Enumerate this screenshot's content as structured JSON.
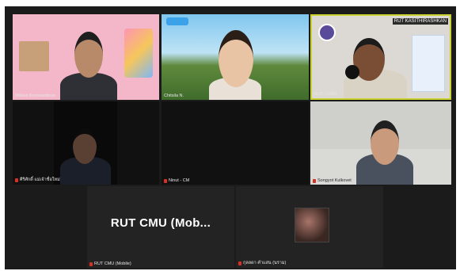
{
  "participants": [
    {
      "name": "Wilwat Komolaritinun",
      "speaking": false
    },
    {
      "name": "Chitsila N.",
      "speaking": false
    },
    {
      "name": "RUT - CMU",
      "speaking": true,
      "overlay": "RUT KASITHIRASHKAN"
    },
    {
      "name": "ศิริศักดิ์ แม่เจ้าชื่อใหม่",
      "muted": true
    },
    {
      "name": "Ninut - CM",
      "muted": true
    },
    {
      "name": "Songyot Kulkovet",
      "muted": true
    },
    {
      "name": "RUT CMU (Mobile)",
      "muted": true,
      "display_text": "RUT  CMU  (Mob..."
    },
    {
      "name": "กุลลดา คำแสน (นราม)",
      "muted": true
    }
  ],
  "colors": {
    "active_border": "#c9d22e",
    "mic_muted": "#d93025"
  }
}
